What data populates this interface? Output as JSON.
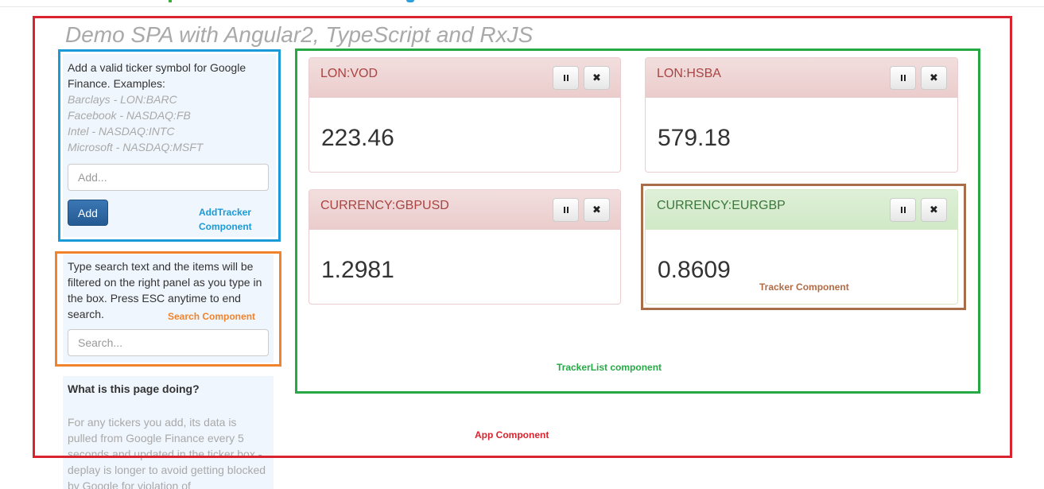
{
  "app_title": "Demo SPA with Angular2, TypeScript and RxJS",
  "add_tracker": {
    "help_text": "Add a valid ticker symbol for Google Finance. Examples:",
    "examples": [
      "Barclays - LON:BARC",
      "Facebook - NASDAQ:FB",
      "Intel - NASDAQ:INTC",
      "Microsoft - NASDAQ:MSFT"
    ],
    "input_placeholder": "Add...",
    "button_label": "Add"
  },
  "search": {
    "help_text": "Type search text and the items will be filtered on the right panel as you type in the box. Press ESC anytime to end search.",
    "input_placeholder": "Search..."
  },
  "about": {
    "title": "What is this page doing?",
    "text": "For any tickers you add, its data is pulled from Google Finance every 5 seconds and updated in the ticker box - deplay is longer to avoid getting blocked by Google for violation of"
  },
  "trackers": [
    {
      "ticker": "LON:VOD",
      "price": "223.46",
      "state": "down"
    },
    {
      "ticker": "LON:HSBA",
      "price": "579.18",
      "state": "down"
    },
    {
      "ticker": "CURRENCY:GBPUSD",
      "price": "1.2981",
      "state": "down"
    },
    {
      "ticker": "CURRENCY:EURGBP",
      "price": "0.8609",
      "state": "up"
    }
  ],
  "annotations": {
    "app": "App Component",
    "tracker_list": "TrackerList component",
    "add_tracker": "AddTracker Component",
    "search": "Search Component",
    "tracker": "Tracker Component"
  },
  "colors": {
    "app_outline": "#d9232e",
    "tracker_list_outline": "#26a845",
    "add_tracker_outline": "#1a9ad8",
    "search_outline": "#f0832c",
    "tracker_outline": "#a86e4a",
    "down_panel": "#f2dede",
    "up_panel": "#dff0d8"
  }
}
